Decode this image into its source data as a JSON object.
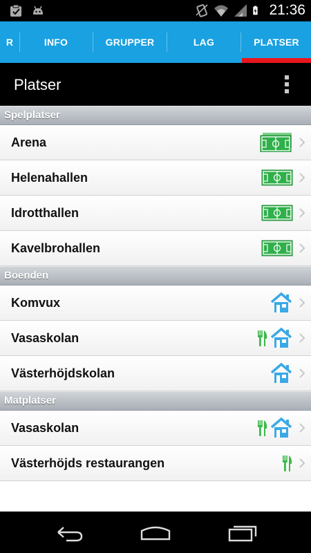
{
  "status": {
    "time": "21:36"
  },
  "tabs": [
    {
      "label": "R"
    },
    {
      "label": "INFO"
    },
    {
      "label": "GRUPPER"
    },
    {
      "label": "LAG"
    },
    {
      "label": "PLATSER"
    }
  ],
  "actionbar": {
    "title": "Platser"
  },
  "sections": {
    "spelplatser": {
      "title": "Spelplatser",
      "items": [
        {
          "label": "Arena",
          "icons": [
            "soccer-field-icon"
          ]
        },
        {
          "label": "Helenahallen",
          "icons": [
            "soccer-field-icon"
          ]
        },
        {
          "label": "Idrotthallen",
          "icons": [
            "soccer-field-icon"
          ]
        },
        {
          "label": "Kavelbrohallen",
          "icons": [
            "soccer-field-icon"
          ]
        }
      ]
    },
    "boenden": {
      "title": "Boenden",
      "items": [
        {
          "label": "Komvux",
          "icons": [
            "house-icon"
          ]
        },
        {
          "label": "Vasaskolan",
          "icons": [
            "fork-knife-icon",
            "house-icon"
          ]
        },
        {
          "label": "Västerhöjdskolan",
          "icons": [
            "house-icon"
          ]
        }
      ]
    },
    "matplatser": {
      "title": "Matplatser",
      "items": [
        {
          "label": "Vasaskolan",
          "icons": [
            "fork-knife-icon",
            "house-icon"
          ]
        },
        {
          "label": "Västerhöjds restaurangen",
          "icons": [
            "fork-knife-icon"
          ]
        }
      ]
    }
  },
  "colors": {
    "tabbar": "#1aa1e1",
    "tab_indicator": "#e8161c",
    "field_green": "#2fb04a",
    "house_blue": "#3aa9e6",
    "cutlery_green": "#3cb84a"
  }
}
